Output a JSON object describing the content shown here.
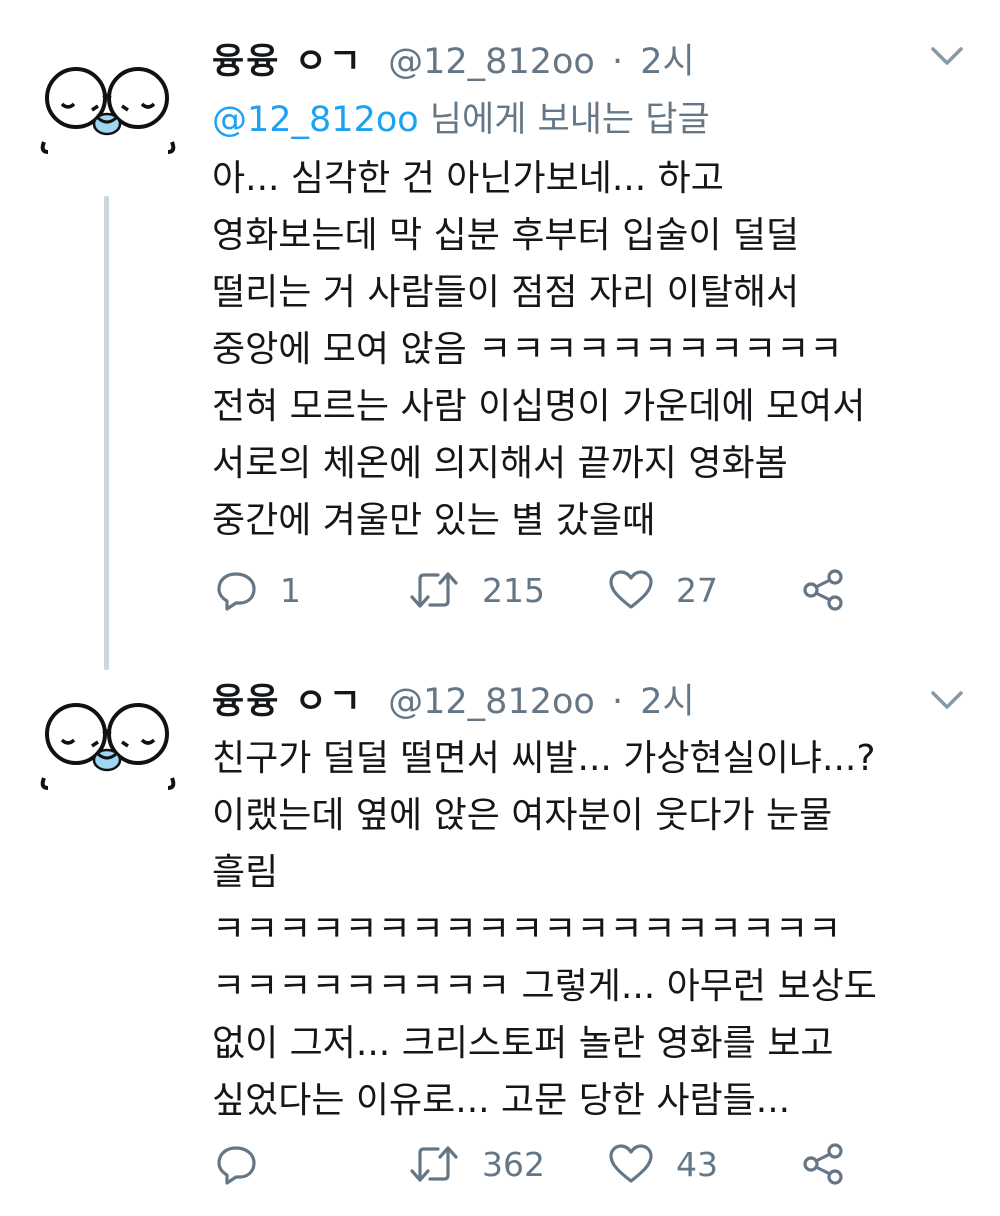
{
  "tweets": [
    {
      "name": "융융 ㅇㄱ",
      "handle": "@12_812oo",
      "separator": "·",
      "time": "2시",
      "reply_to": {
        "mention": "@12_812oo",
        "suffix": " 님에게 보내는 답글"
      },
      "text": "아... 심각한 건 아닌가보네... 하고\n영화보는데 막 십분 후부터 입술이 덜덜\n떨리는 거 사람들이 점점 자리 이탈해서\n중앙에 모여 앉음 ㅋㅋㅋㅋㅋㅋㅋㅋㅋㅋㅋ\n전혀 모르는 사람 이십명이 가운데에 모여서\n서로의 체온에 의지해서 끝까지 영화봄\n중간에 겨울만 있는 별 갔을때",
      "replies": "1",
      "retweets": "215",
      "likes": "27"
    },
    {
      "name": "융융 ㅇㄱ",
      "handle": "@12_812oo",
      "separator": "·",
      "time": "2시",
      "text": "친구가 덜덜 떨면서 씨발... 가상현실이냐...?\n이랬는데 옆에 앉은 여자분이 웃다가 눈물\n흘림\nㅋㅋㅋㅋㅋㅋㅋㅋㅋㅋㅋㅋㅋㅋㅋㅋㅋㅋㅋ\nㅋㅋㅋㅋㅋㅋㅋㅋㅋ 그렇게... 아무런 보상도\n없이 그저... 크리스토퍼 놀란 영화를 보고\n싶었다는 이유로... 고문 당한 사람들...",
      "replies": "",
      "retweets": "362",
      "likes": "43"
    }
  ],
  "icons": {
    "avatar": "glasses-face-avatar",
    "menu": "chevron-down-icon",
    "reply": "reply-bubble-icon",
    "retweet": "retweet-icon",
    "like": "heart-icon",
    "share": "share-icon"
  },
  "colors": {
    "link": "#1da1f2",
    "secondary": "#657786",
    "text": "#14171a",
    "thread_line": "#ccd6dd",
    "avatar_tear": "#9fd6f2"
  }
}
